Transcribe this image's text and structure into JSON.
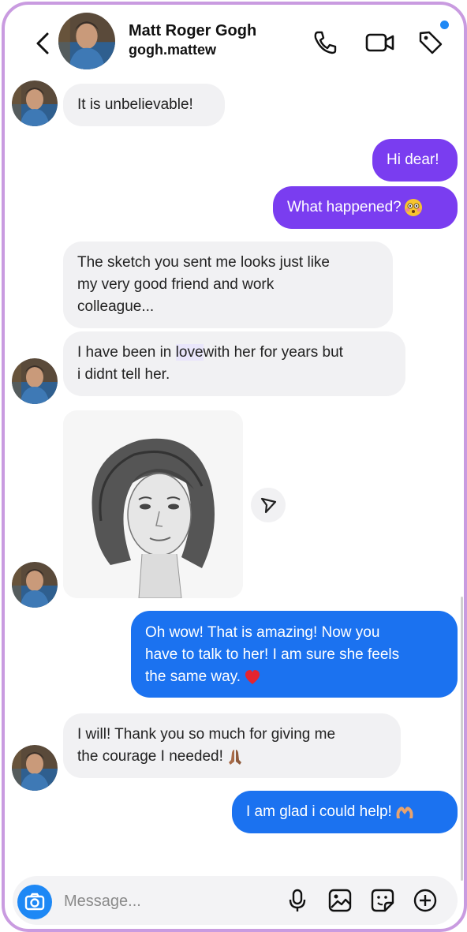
{
  "header": {
    "name": "Matt Roger Gogh",
    "username": "gogh.mattew"
  },
  "messages": [
    {
      "from": "them",
      "text": "It is unbelievable!"
    },
    {
      "from": "me",
      "text": "Hi dear!"
    },
    {
      "from": "me",
      "text": "What happened?",
      "emoji": "flushed-face"
    },
    {
      "from": "them",
      "lines": [
        "The sketch you sent me looks just like",
        "my very good friend and work",
        "colleague..."
      ]
    },
    {
      "from": "them",
      "line1_pre": "I have been in ",
      "line1_hl": "love",
      "line1_post": "with her for years but",
      "line2": "i didnt tell her."
    },
    {
      "from": "them",
      "type": "image",
      "image": "pencil-sketch-portrait-woman"
    },
    {
      "from": "me",
      "lines": [
        "Oh wow! That is amazing! Now you",
        "have to talk to her! I am sure she feels",
        "the same way."
      ],
      "emoji": "red-heart"
    },
    {
      "from": "them",
      "lines": [
        "I will! Thank you so much for giving me",
        "the courage I needed!"
      ],
      "emoji": "folded-hands"
    },
    {
      "from": "me",
      "text": "I am glad i could help!",
      "emoji": "heart-hands"
    }
  ],
  "composer": {
    "placeholder": "Message..."
  },
  "colors": {
    "frame": "#c99be0",
    "outgoing_purple": "#7a3df0",
    "outgoing_blue": "#1b72f0",
    "incoming": "#f1f1f3",
    "accent": "#1e88f5"
  }
}
